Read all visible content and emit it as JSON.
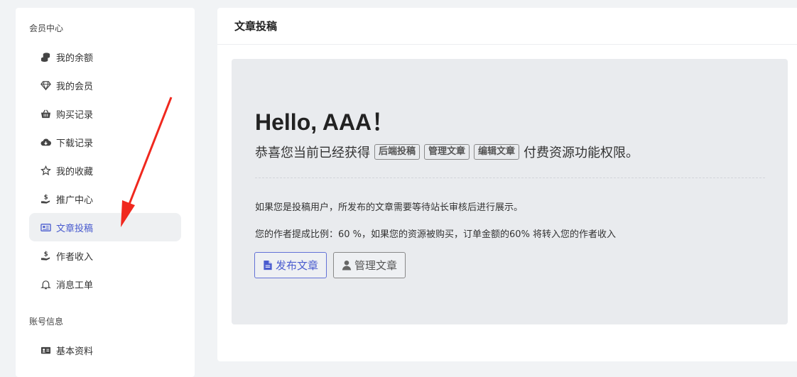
{
  "sidebar": {
    "section_member": "会员中心",
    "section_account": "账号信息",
    "items": [
      {
        "label": "我的余额",
        "icon": "coins-icon"
      },
      {
        "label": "我的会员",
        "icon": "diamond-icon"
      },
      {
        "label": "购买记录",
        "icon": "basket-icon"
      },
      {
        "label": "下载记录",
        "icon": "cloud-download-icon"
      },
      {
        "label": "我的收藏",
        "icon": "star-icon"
      },
      {
        "label": "推广中心",
        "icon": "hand-dollar-icon"
      },
      {
        "label": "文章投稿",
        "icon": "newspaper-icon",
        "active": true
      },
      {
        "label": "作者收入",
        "icon": "hand-dollar-icon"
      },
      {
        "label": "消息工单",
        "icon": "bell-icon"
      },
      {
        "label": "基本资料",
        "icon": "id-card-icon"
      }
    ]
  },
  "main": {
    "title": "文章投稿",
    "greeting": "Hello, AAA！",
    "perm_prefix": "恭喜您当前已经获得",
    "perm_tags": [
      "后端投稿",
      "管理文章",
      "编辑文章"
    ],
    "perm_suffix": "付费资源功能权限。",
    "info_review": "如果您是投稿用户，所发布的文章需要等待站长审核后进行展示。",
    "info_commission": "您的作者提成比例：60 %，如果您的资源被购买，订单金额的60% 将转入您的作者收入",
    "btn_publish": "发布文章",
    "btn_manage": "管理文章"
  },
  "colors": {
    "accent": "#4a5ccf",
    "annotation_arrow": "#f0281e",
    "panel_bg": "#e9ebee"
  }
}
